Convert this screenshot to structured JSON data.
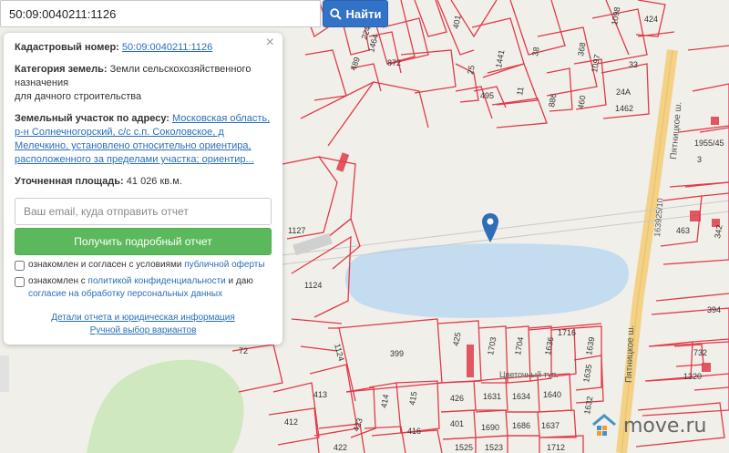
{
  "search": {
    "value": "50:09:0040211:1126",
    "button_label": "Найти"
  },
  "panel": {
    "cadastral_label": "Кадастровый номер:",
    "cadastral_value": "50:09:0040211:1126",
    "category_label": "Категория земель:",
    "category_value": "Земли сельскохозяйственного назначения",
    "category_value_2": "для дачного строительства",
    "address_label": "Земельный участок по адресу:",
    "address_value": "Московская область, р-н Солнечногорский, с/с с.п. Соколовское, д Мелечкино, установлено относительно ориентира, расположенного за пределами участка; ориентир...",
    "area_label": "Уточненная площадь:",
    "area_value": "41 026 кв.м.",
    "email_placeholder": "Ваш email, куда отправить отчет",
    "report_button": "Получить подробный отчет",
    "consent1_text": "ознакомлен и согласен с условиями ",
    "consent1_link": "публичной оферты",
    "consent2_text": "ознакомлен с ",
    "consent2_link": "политикой конфиденциальности",
    "consent2_text_b": " и даю ",
    "consent2_link_b": "согласие на обработку персональных данных",
    "details_link": "Детали отчета и юридическая информация",
    "manual_link": "Ручной выбор вариантов"
  },
  "map": {
    "parcel_labels": [
      "1464",
      "872",
      "489",
      "224",
      "401",
      "1441",
      "11",
      "495",
      "25",
      "38",
      "1098",
      "424",
      "368",
      "1097",
      "33",
      "24А",
      "886",
      "460",
      "1462",
      "1955/45",
      "3",
      "342",
      "463",
      "1127",
      "1124",
      "399",
      "425",
      "1703",
      "1704",
      "1636",
      "1639",
      "1716",
      "1635",
      "1320",
      "732",
      "394",
      "413",
      "414",
      "415",
      "426",
      "1631",
      "1634",
      "1640",
      "1632",
      "412",
      "423",
      "416",
      "401",
      "1690",
      "1686",
      "1637",
      "1525",
      "1523",
      "1712",
      "72",
      "422",
      "36"
    ],
    "road_labels": [
      "Пятницкое ш.",
      "Пятницкое ш.",
      "163925/10",
      "Цветочный туп."
    ],
    "parcel_number_near_marker": "6",
    "parcel_number_1124b": "1124"
  },
  "logo": {
    "text": "move.ru"
  },
  "colors": {
    "accent": "#3273c7",
    "green": "#5cb85c",
    "parcel": "#e03a4a",
    "water": "#c3dcef",
    "forest": "#cfe8bf",
    "road": "#f3d185",
    "marker": "#2f6db8"
  }
}
